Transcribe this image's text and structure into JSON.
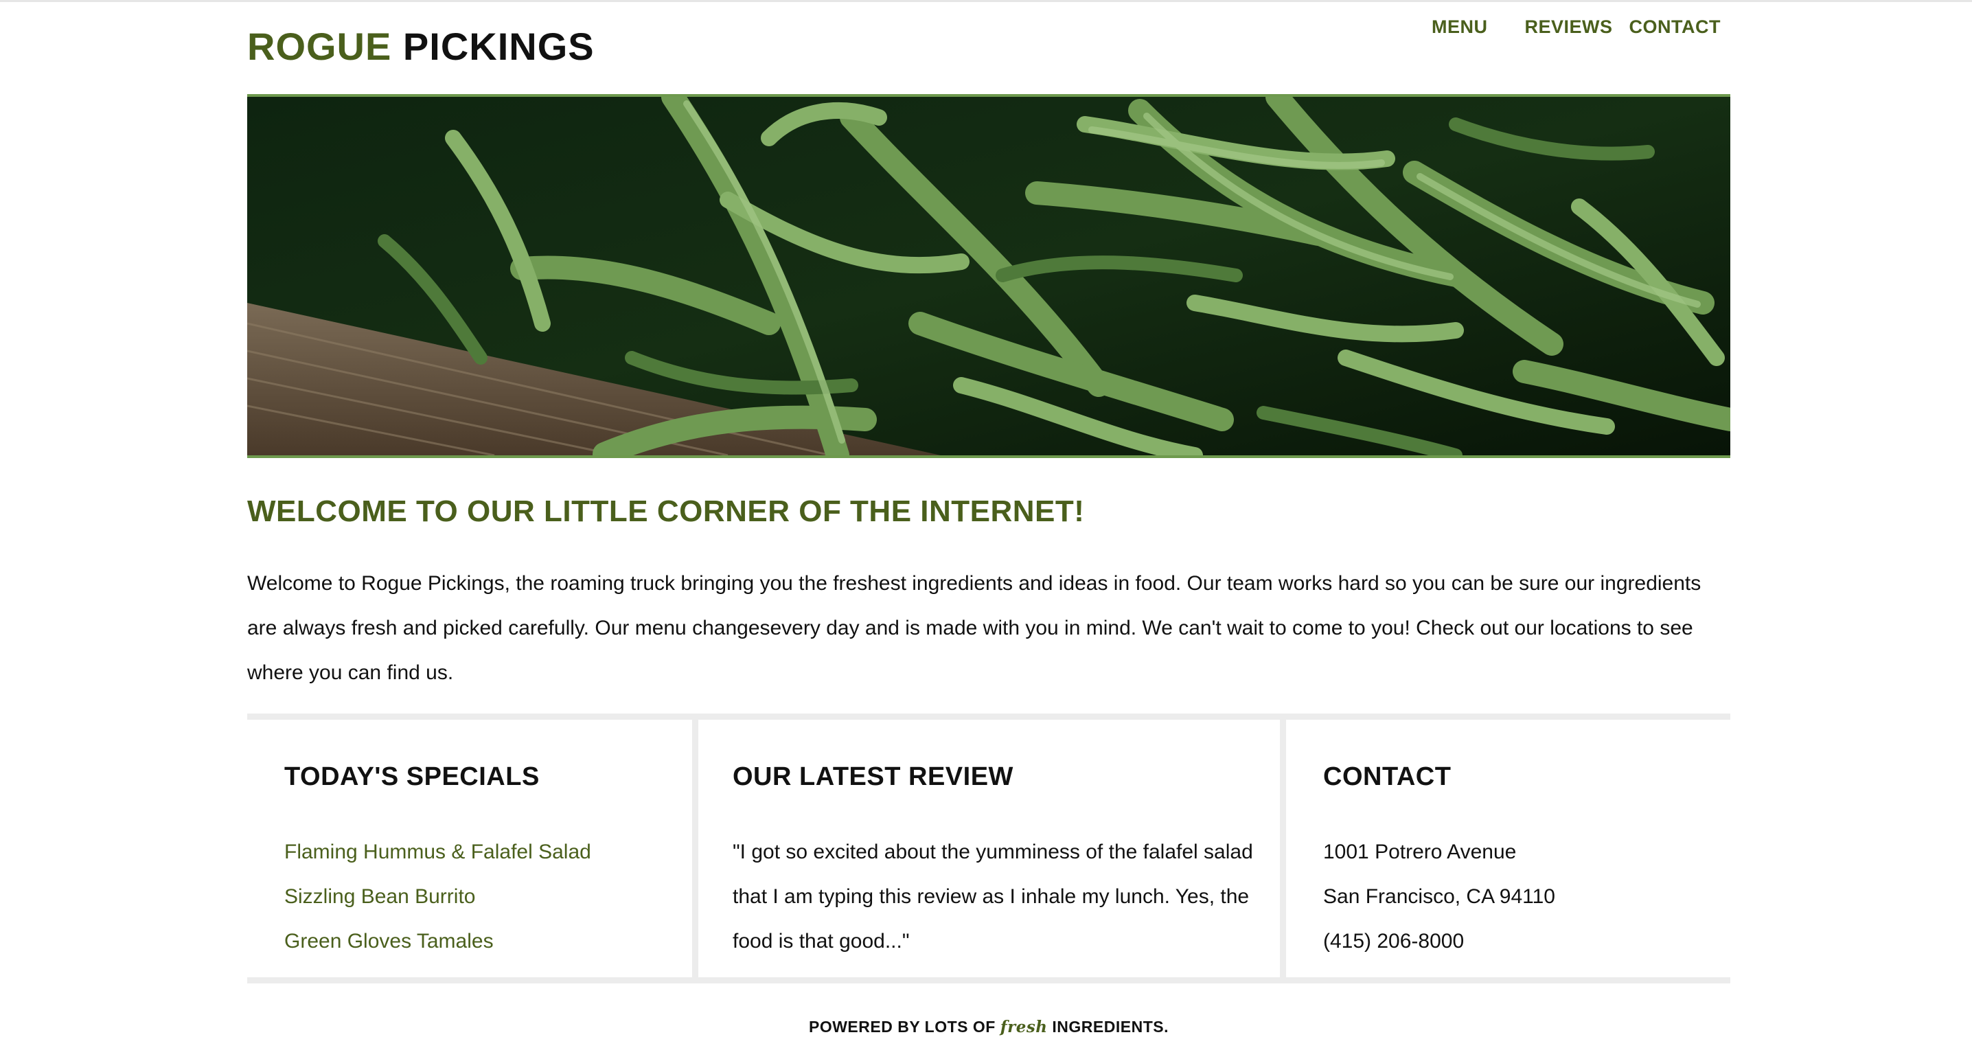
{
  "colors": {
    "accent": "#4a5f1c"
  },
  "header": {
    "logo_part1": "ROGUE",
    "logo_part2": "PICKINGS",
    "nav": {
      "menu": "MENU",
      "reviews": "REVIEWS",
      "contact": "CONTACT"
    }
  },
  "hero": {
    "image": "green-beans-photo"
  },
  "welcome": {
    "title": "WELCOME TO OUR LITTLE CORNER OF THE INTERNET!",
    "body": "Welcome to Rogue Pickings, the roaming truck bringing you the freshest ingredients and ideas in food. Our team works hard so you can be sure our ingredients are always fresh and picked carefully. Our menu changesevery day and is made with you in mind. We can't wait to come to you! Check out our locations to see where you can find us."
  },
  "specials": {
    "title": "TODAY'S SPECIALS",
    "items": [
      "Flaming Hummus & Falafel Salad",
      "Sizzling Bean Burrito",
      "Green Gloves Tamales"
    ]
  },
  "review": {
    "title": "OUR LATEST REVIEW",
    "quote": "\"I got so excited about the yumminess of the falafel salad that I am typing this review as I inhale my lunch. Yes, the food is that good...\""
  },
  "contact": {
    "title": "CONTACT",
    "address1": "1001 Potrero Avenue",
    "address2": "San Francisco, CA 94110",
    "phone": "(415) 206-8000"
  },
  "footer": {
    "prefix": "POWERED BY LOTS OF",
    "fresh": "fresh",
    "suffix": "INGREDIENTS."
  }
}
